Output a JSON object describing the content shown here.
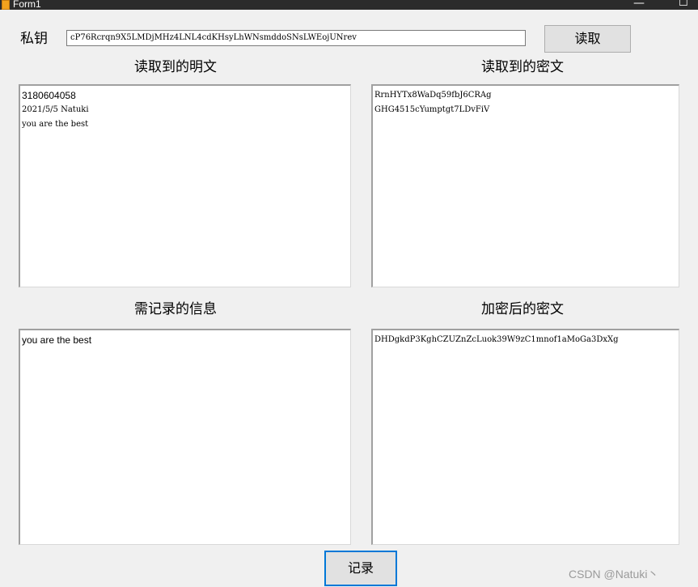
{
  "window": {
    "title": "Form1",
    "minimize_glyph": "—",
    "maximize_glyph": "☐"
  },
  "key": {
    "label": "私钥",
    "value": "cP76Rcrqn9X5LMDjMHz4LNL4cdKHsyLhWNsmddoSNsLWEojUNrev",
    "read_button": "读取"
  },
  "sections": {
    "plain_title": "读取到的明文",
    "plain_lines": [
      "3180604058",
      "2021/5/5 Natuki",
      "you are the best"
    ],
    "cipher_title": "读取到的密文",
    "cipher_lines": [
      "RrnHYTx8WaDq59fbJ6CRAg",
      "GHG4515cYumptgt7LDvFiV"
    ],
    "record_title": "需记录的信息",
    "record_lines": [
      "you are the best"
    ],
    "encrypted_title": "加密后的密文",
    "encrypted_lines": [
      "DHDgkdP3KghCZUZnZcLuok39W9zC1mnof1aMoGa3DxXg"
    ]
  },
  "actions": {
    "record_button": "记录"
  },
  "watermark": "CSDN @Natuki丶",
  "colors": {
    "titlebar": "#2b2b2b",
    "window_bg": "#f0f0f0",
    "button_bg": "#e1e1e1",
    "focus_border": "#0078d7"
  },
  "icons": {
    "app": "form-app-icon",
    "minimize": "minimize-icon",
    "maximize": "maximize-icon"
  }
}
